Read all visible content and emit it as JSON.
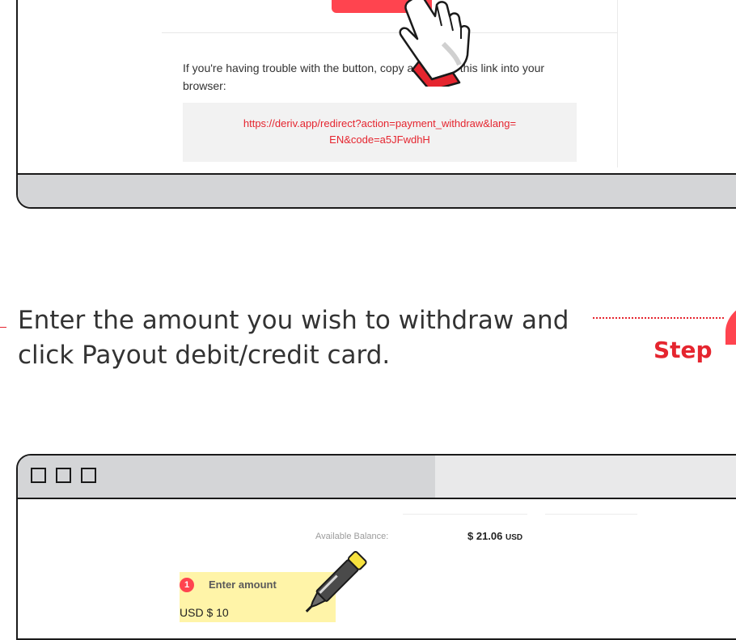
{
  "email": {
    "trouble_text": "If you're having trouble with the button, copy and paste this link into your browser:",
    "link_line1": "https://deriv.app/redirect?action=payment_withdraw&lang=",
    "link_line2": "EN&code=a5JFwdhH"
  },
  "step": {
    "instruction": "Enter the amount you wish to withdraw and click Payout debit/credit card.",
    "label": "Step"
  },
  "cashier": {
    "balance_label": "Available Balance:",
    "balance_amount": "$ 21.06",
    "balance_currency": "USD",
    "step_number": "1",
    "enter_amount_label": "Enter amount",
    "amount_value": "USD $ 10"
  },
  "colors": {
    "accent": "#ff444f",
    "link": "#e5252f",
    "frame_gray": "#d4d5d7",
    "highlight": "#fff4a8"
  }
}
